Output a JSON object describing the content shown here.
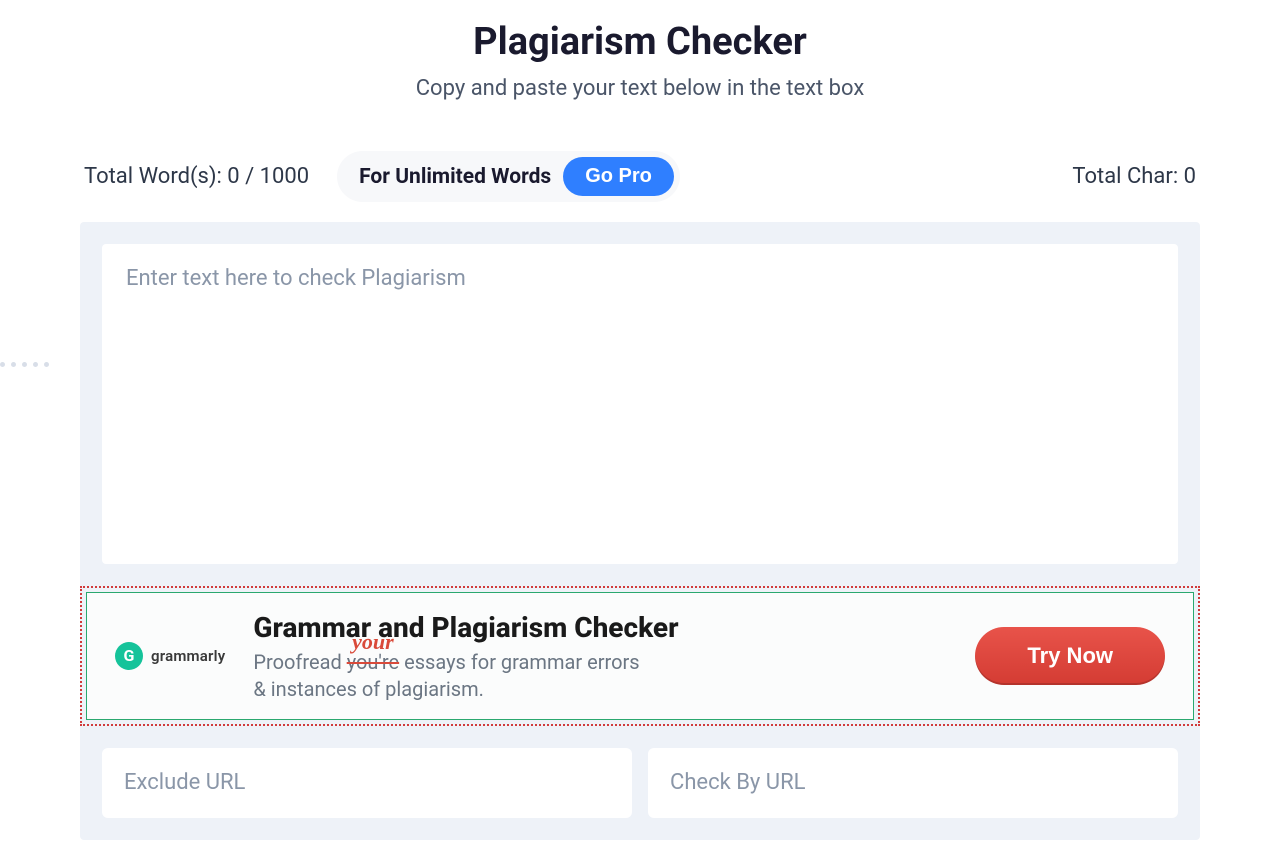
{
  "header": {
    "title": "Plagiarism Checker",
    "subtitle": "Copy and paste your text below in the text box"
  },
  "stats": {
    "word_label": "Total Word(s): 0 / 1000",
    "char_label": "Total Char: 0",
    "unlimited_text": "For Unlimited Words",
    "go_pro_label": "Go Pro"
  },
  "editor": {
    "placeholder": "Enter text here to check Plagiarism"
  },
  "ad": {
    "brand": "grammarly",
    "logo_letter": "G",
    "heading": "Grammar and Plagiarism Checker",
    "line1_before": "Proofread ",
    "line1_strike": "you're",
    "line1_correction": "your",
    "line1_after": " essays for grammar errors",
    "line2": "& instances of plagiarism.",
    "cta_label": "Try Now"
  },
  "inputs": {
    "exclude_placeholder": "Exclude URL",
    "check_placeholder": "Check By URL"
  }
}
